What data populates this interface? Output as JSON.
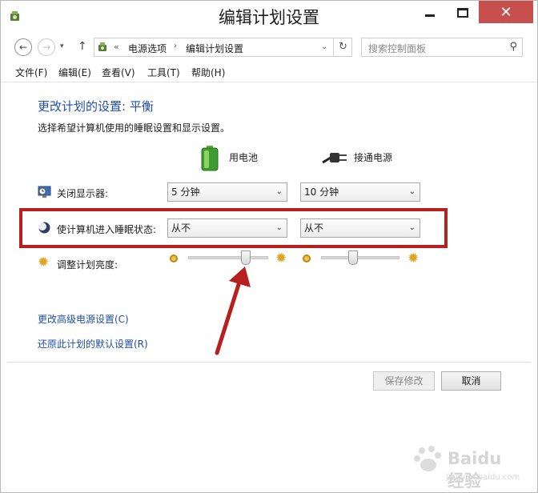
{
  "window": {
    "title": "编辑计划设置",
    "close_glyph": "✕"
  },
  "nav": {
    "back_glyph": "←",
    "forward_glyph": "→",
    "dropdown_glyph": "▾",
    "up_glyph": "↑"
  },
  "address": {
    "overflow_glyph": "«",
    "crumbs": [
      "电源选项",
      "编辑计划设置"
    ],
    "sep_glyph": "›",
    "dropdown_glyph": "⌄",
    "refresh_glyph": "↻"
  },
  "search": {
    "placeholder": "搜索控制面板",
    "icon_glyph": "⚲"
  },
  "menu": {
    "items": [
      "文件(F)",
      "编辑(E)",
      "查看(V)",
      "工具(T)",
      "帮助(H)"
    ]
  },
  "plan": {
    "heading": "更改计划的设置: 平衡",
    "subtitle": "选择希望计算机使用的睡眠设置和显示设置。",
    "columns": {
      "battery": "用电池",
      "plugged": "接通电源"
    },
    "rows": {
      "display_off": {
        "label": "关闭显示器:",
        "battery_value": "5 分钟",
        "plugged_value": "10 分钟"
      },
      "sleep": {
        "label": "使计算机进入睡眠状态:",
        "battery_value": "从不",
        "plugged_value": "从不"
      },
      "brightness": {
        "label": "调整计划亮度:",
        "battery_level": 0.75,
        "plugged_level": 0.4
      }
    },
    "select_arrow": "⌄",
    "sun_glyph": "✹"
  },
  "links": {
    "advanced": "更改高级电源设置(C)",
    "restore": "还原此计划的默认设置(R)"
  },
  "buttons": {
    "save": "保存修改",
    "cancel": "取消"
  },
  "watermark": {
    "text": "Baidu经验",
    "url": "jingyan.baidu.com"
  },
  "colors": {
    "link": "#1f4fa8",
    "highlight": "#b7201f",
    "close": "#c74f4d"
  }
}
